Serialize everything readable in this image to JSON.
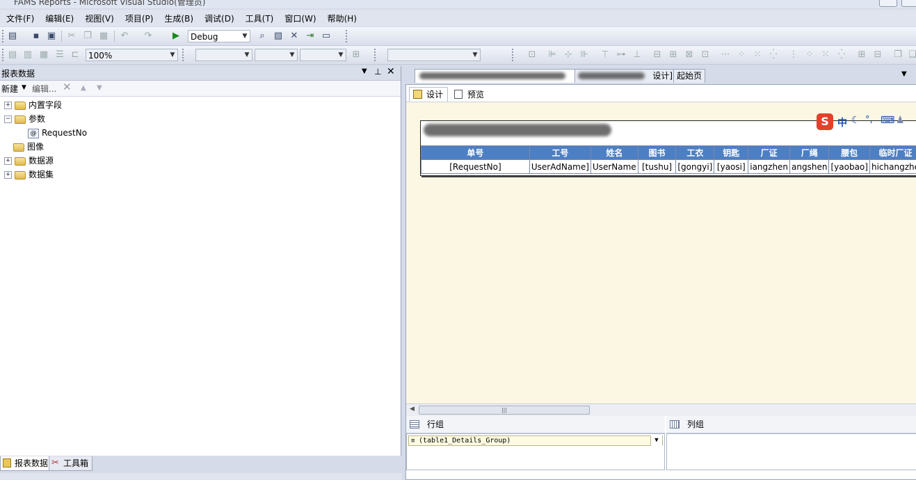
{
  "window": {
    "title": "FAMS Reports - Microsoft Visual Studio(管理员)"
  },
  "menu": [
    "文件(F)",
    "编辑(E)",
    "视图(V)",
    "项目(P)",
    "生成(B)",
    "调试(D)",
    "工具(T)",
    "窗口(W)",
    "帮助(H)"
  ],
  "toolbar1": {
    "config": "Debug"
  },
  "toolbar2": {
    "zoom": "100%"
  },
  "report_data_panel": {
    "title": "报表数据",
    "new_label": "新建",
    "edit_label": "编辑...",
    "tree": {
      "builtin_fields": "内置字段",
      "parameters": "参数",
      "param_request_no": "RequestNo",
      "images": "图像",
      "data_sources": "数据源",
      "datasets": "数据集"
    },
    "tabs": {
      "report_data": "报表数据",
      "toolbox": "工具箱"
    }
  },
  "doc_tabs": {
    "design_suffix": "设计]",
    "start_page": "起始页"
  },
  "editor_tabs": {
    "design": "设计",
    "preview": "预览"
  },
  "table": {
    "headers": [
      "单号",
      "工号",
      "姓名",
      "图书",
      "工衣",
      "钥匙",
      "厂证",
      "厂绳",
      "腰包",
      "临时厂证"
    ],
    "row": [
      "[RequestNo]",
      "UserAdName]",
      "UserName",
      "[tushu]",
      "[gongyi]",
      "[yaosi]",
      "iangzhen",
      "angshen",
      "[yaobao]",
      "hichangzhe"
    ]
  },
  "grouping": {
    "row_groups": "行组",
    "col_groups": "列组",
    "row_group_item": "(table1_Details_Group)"
  },
  "ime": {
    "lang": "中"
  }
}
